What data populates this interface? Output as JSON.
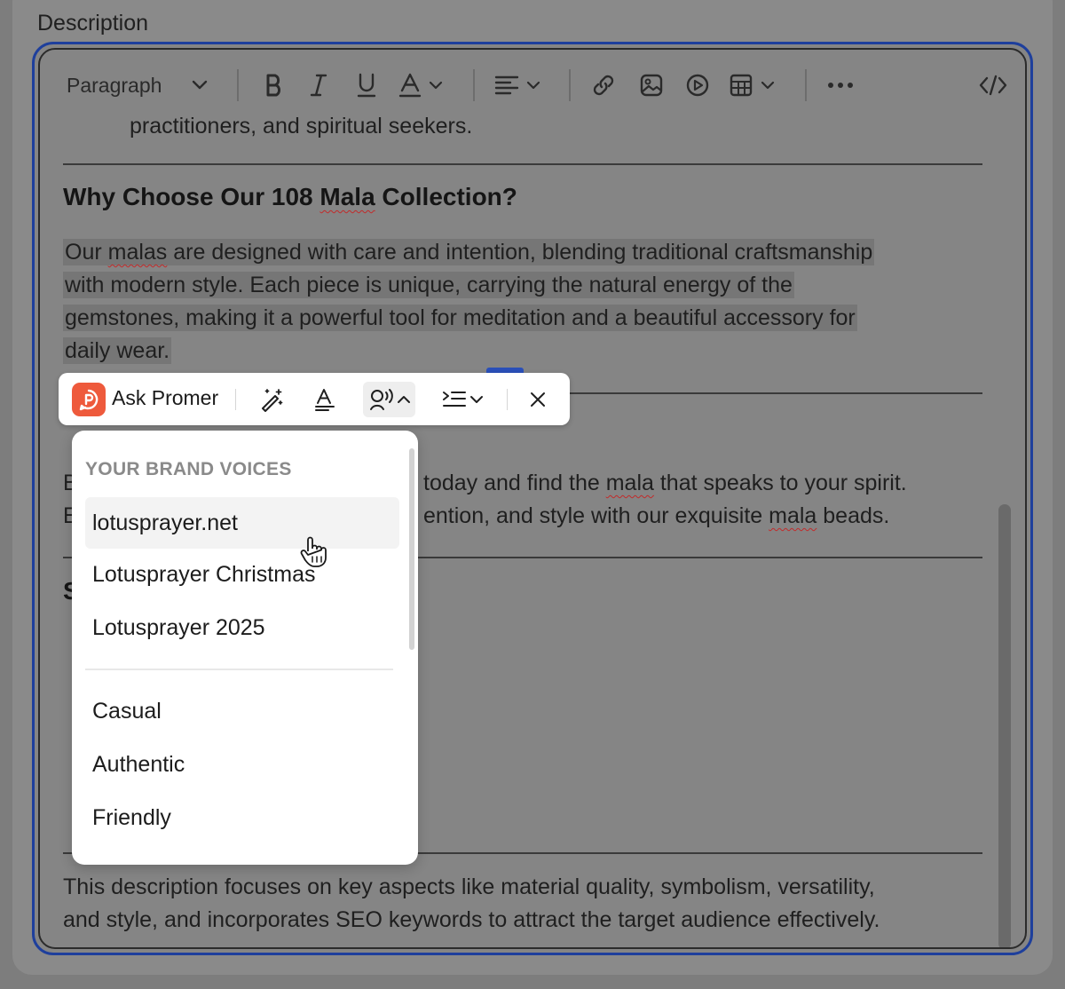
{
  "field": {
    "label": "Description"
  },
  "toolbar": {
    "block_format": "Paragraph"
  },
  "content": {
    "top_text": "practitioners, and spiritual seekers.",
    "heading1": {
      "pre": "Why Choose Our 108 ",
      "sq": "Mala",
      "post": " Collection?"
    },
    "para1": {
      "line1_a": "Our ",
      "line1_sq": "malas",
      "line1_b": " are designed with care and intention, blending traditional craftsmanship",
      "line2": "with modern style. Each piece is unique, carrying the natural energy of the",
      "line3": "gemstones, making it a powerful tool for meditation and a beautiful accessory for",
      "line4": "daily wear."
    },
    "para2": {
      "line1_start": "B",
      "line1_a": "today and find the ",
      "line1_sq": "mala",
      "line1_b": " that speaks to your spirit.",
      "line2_start": "E",
      "line2_a": "ention, and style with our exquisite ",
      "line2_sq": "mala",
      "line2_b": " beads."
    },
    "heading3_start": "S",
    "footer": {
      "line1": "This description focuses on key aspects like material quality, symbolism, versatility,",
      "line2": "and style, and incorporates SEO keywords to attract the target audience effectively."
    }
  },
  "askbar": {
    "label": "Ask Promer"
  },
  "dropdown": {
    "header": "YOUR BRAND VOICES",
    "brand_voices": [
      "lotusprayer.net",
      "Lotusprayer Christmas",
      "Lotusprayer 2025"
    ],
    "tones": [
      "Casual",
      "Authentic",
      "Friendly"
    ]
  },
  "colors": {
    "accent": "#1e3f9c",
    "brand": "#ee5a3c"
  }
}
